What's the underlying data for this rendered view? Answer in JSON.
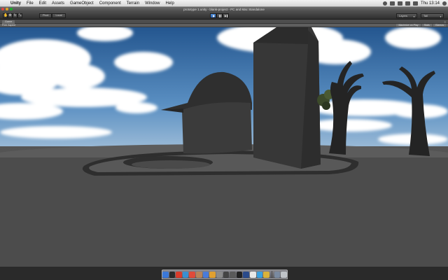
{
  "menubar": {
    "apple_label": "",
    "items": [
      {
        "label": "Unity",
        "app": true
      },
      {
        "label": "File"
      },
      {
        "label": "Edit"
      },
      {
        "label": "Assets"
      },
      {
        "label": "GameObject"
      },
      {
        "label": "Component"
      },
      {
        "label": "Terrain"
      },
      {
        "label": "Window"
      },
      {
        "label": "Help"
      }
    ],
    "clock": "Thu 13:14"
  },
  "window": {
    "title": "prototype 1.unity - blank-project - PC and Mac Standalone"
  },
  "toolbar": {
    "transform_tools": [
      "hand-tool",
      "move-tool",
      "rotate-tool",
      "scale-tool"
    ],
    "pivot_label": "Pivot",
    "space_label": "Local",
    "play_active": true,
    "layers_label": "Layers",
    "layout_label": "Tall"
  },
  "game_tab": {
    "label": "Game",
    "aspect_label": "Free Aspect",
    "maximize_label": "Maximize on Play",
    "stats_label": "Stats",
    "gizmos_label": "Gizmos"
  },
  "scene": {
    "sky_top": "#2a5f9c",
    "sky_horizon": "#a8c4dc",
    "ground_color": "#4d4d4d",
    "object_color": "#323232"
  },
  "dock": {
    "icons": [
      {
        "name": "finder-icon",
        "color": "#3b78d8"
      },
      {
        "name": "dashboard-icon",
        "color": "#2b2b2b"
      },
      {
        "name": "mail-icon",
        "color": "#d93b2b"
      },
      {
        "name": "safari-icon",
        "color": "#3a8fd0"
      },
      {
        "name": "ical-icon",
        "color": "#e04a3a"
      },
      {
        "name": "addressbook-icon",
        "color": "#b7845a"
      },
      {
        "name": "itunes-icon",
        "color": "#4a7bd9"
      },
      {
        "name": "iphoto-icon",
        "color": "#e0a030"
      },
      {
        "name": "preferences-icon",
        "color": "#8a8a8a"
      },
      {
        "name": "unity-icon",
        "color": "#444444"
      },
      {
        "name": "monodevelop-icon",
        "color": "#5a5a5a"
      },
      {
        "name": "terminal-icon",
        "color": "#222222"
      },
      {
        "name": "photoshop-icon",
        "color": "#2a4a8a"
      },
      {
        "name": "textedit-icon",
        "color": "#e8e8e8"
      },
      {
        "name": "skype-icon",
        "color": "#3aa0e0"
      },
      {
        "name": "chrome-icon",
        "color": "#d9b23a"
      },
      {
        "name": "documents-stack-icon",
        "color": "#7a8aa0"
      },
      {
        "name": "trash-icon",
        "color": "#bfc3c8"
      }
    ]
  }
}
